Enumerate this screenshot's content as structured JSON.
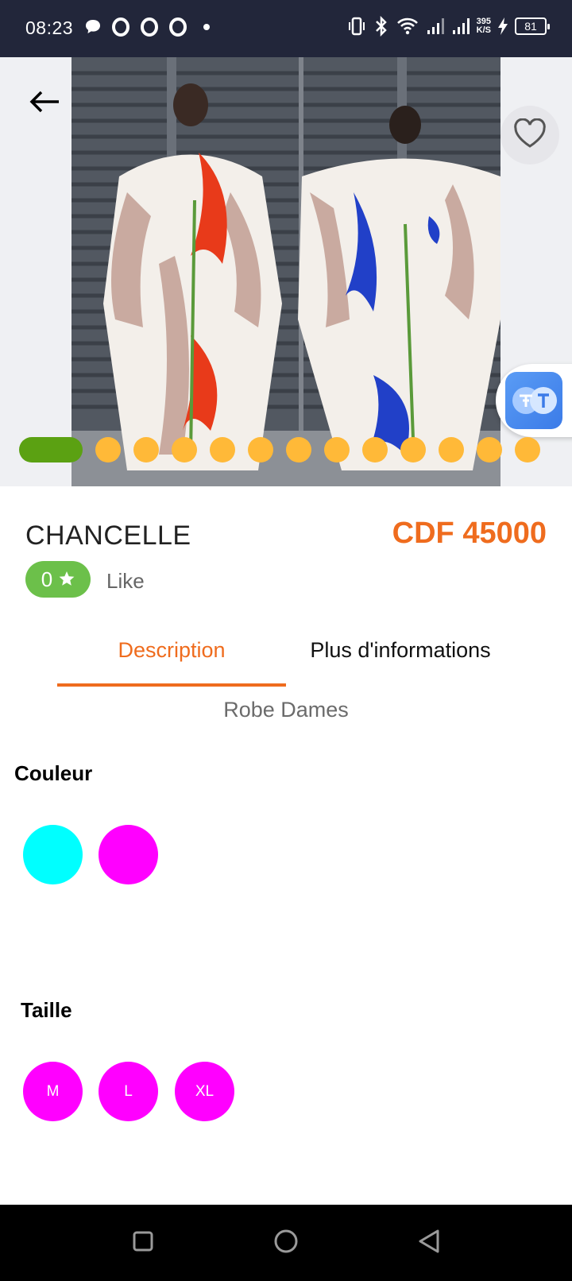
{
  "status_bar": {
    "time": "08:23",
    "network_speed_value": "395",
    "network_speed_unit": "K/S",
    "battery_level": "81"
  },
  "product": {
    "name": "CHANCELLE",
    "price": "CDF 45000",
    "rating": "0",
    "like_label": "Like",
    "category": "Robe Dames",
    "image_count": 13,
    "active_image_index": 0
  },
  "tabs": [
    {
      "label": "Description",
      "active": true
    },
    {
      "label": "Plus d'informations",
      "active": false
    }
  ],
  "color_section": {
    "label": "Couleur",
    "colors": [
      "#00ffff",
      "#ff00ff"
    ]
  },
  "size_section": {
    "label": "Taille",
    "sizes": [
      "M",
      "L",
      "XL"
    ],
    "chip_color": "#ff00ff"
  },
  "theme": {
    "accent": "#ef6c1e",
    "rating_green": "#6cc04a",
    "dot_active": "#5ba112",
    "dot_inactive": "#ffb938",
    "status_bar_bg": "#22263a"
  }
}
